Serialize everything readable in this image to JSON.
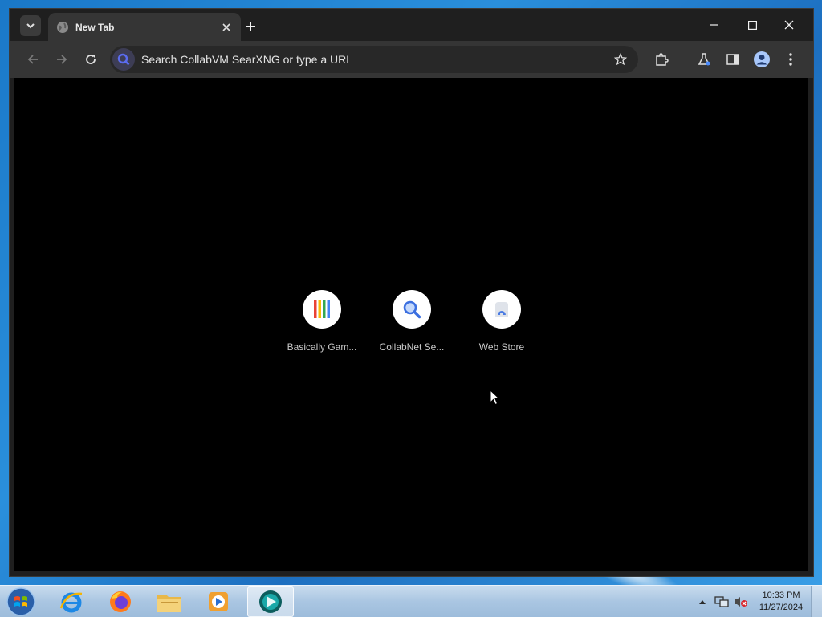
{
  "browser": {
    "tab": {
      "title": "New Tab"
    },
    "omnibox": {
      "placeholder": "Search CollabVM SearXNG or type a URL"
    }
  },
  "shortcuts": [
    {
      "label": "Basically Gam...",
      "icon": "bars-icon"
    },
    {
      "label": "CollabNet Se...",
      "icon": "magnifier-icon"
    },
    {
      "label": "Web Store",
      "icon": "web-store-icon"
    }
  ],
  "taskbar": {
    "apps": [
      "internet-explorer-icon",
      "firefox-icon",
      "file-explorer-icon",
      "media-player-icon",
      "browser-icon"
    ],
    "clock": {
      "time": "10:33 PM",
      "date": "11/27/2024"
    }
  },
  "colors": {
    "omnibox_icon": "#5b6cf0",
    "shortcut_bar_red": "#e94235",
    "shortcut_bar_yellow": "#fbbc04",
    "shortcut_bar_green": "#34a853",
    "shortcut_bar_blue": "#4285f4"
  }
}
